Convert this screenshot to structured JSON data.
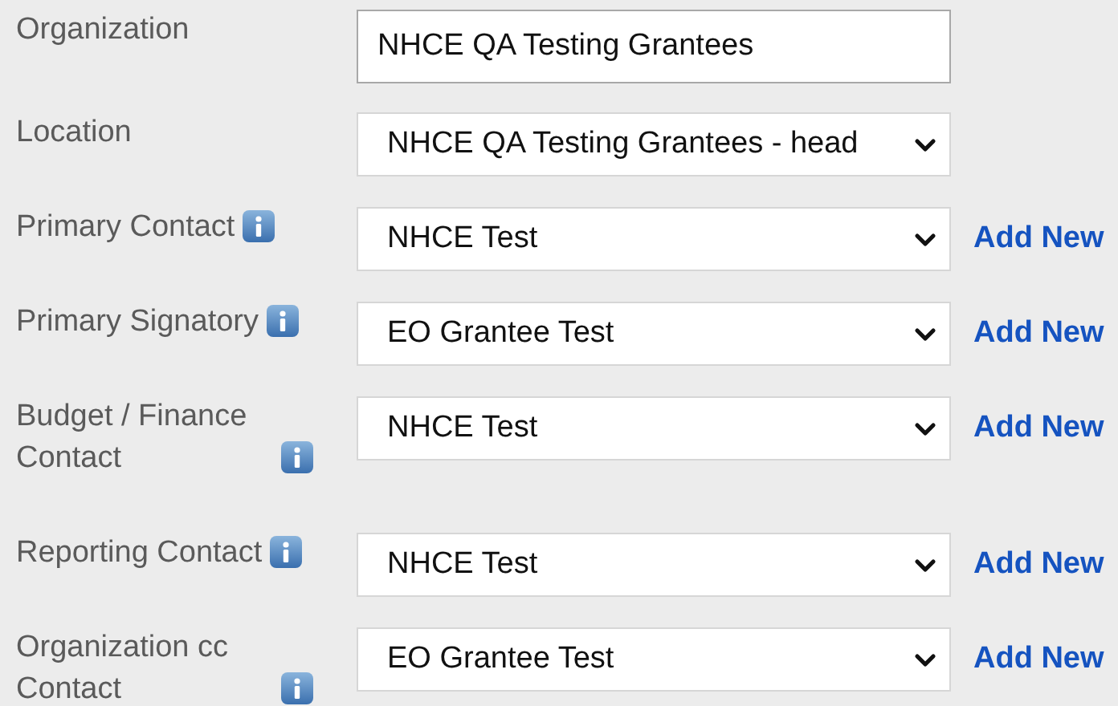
{
  "fields": [
    {
      "label": "Organization",
      "info": false,
      "kind": "text",
      "value": "NHCE QA Testing Grantees"
    },
    {
      "label": "Location",
      "info": false,
      "kind": "select",
      "value": "NHCE QA Testing Grantees - head"
    },
    {
      "label": "Primary Contact",
      "info": true,
      "kind": "select",
      "value": "NHCE Test",
      "add_new": "Add New"
    },
    {
      "label": "Primary Signatory",
      "info": true,
      "kind": "select",
      "value": "EO Grantee Test",
      "add_new": "Add New"
    },
    {
      "label": "Budget / Finance Contact",
      "info": true,
      "kind": "select",
      "value": "NHCE Test",
      "add_new": "Add New"
    },
    {
      "label": "Reporting Contact",
      "info": true,
      "kind": "select",
      "value": "NHCE Test",
      "add_new": "Add New"
    },
    {
      "label": "Organization cc Contact",
      "info": true,
      "kind": "select",
      "value": "EO Grantee Test",
      "add_new": "Add New"
    }
  ]
}
